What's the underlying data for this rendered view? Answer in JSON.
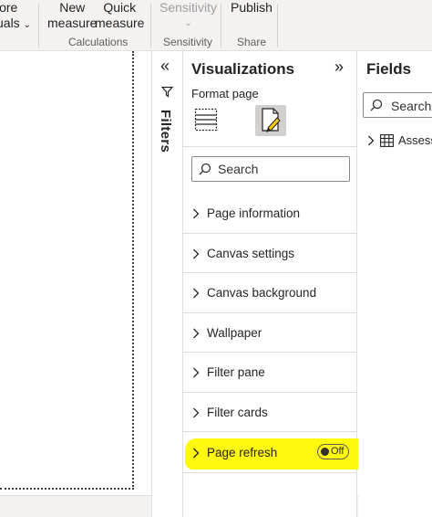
{
  "ribbon": {
    "more_visuals": {
      "line1": "lore",
      "line2": "uals"
    },
    "new_measure": {
      "line1": "New",
      "line2": "measure"
    },
    "quick_measure": {
      "line1": "Quick",
      "line2": "measure"
    },
    "sensitivity": {
      "line1": "Sensitivity"
    },
    "publish": {
      "line1": "Publish"
    },
    "groups": {
      "calculations": "Calculations",
      "sensitivity": "Sensitivity",
      "share": "Share"
    }
  },
  "filters": {
    "label": "Filters"
  },
  "visualizations": {
    "title": "Visualizations",
    "subtitle": "Format page",
    "search_placeholder": "Search",
    "sections": [
      {
        "label": "Page information"
      },
      {
        "label": "Canvas settings"
      },
      {
        "label": "Canvas background"
      },
      {
        "label": "Wallpaper"
      },
      {
        "label": "Filter pane"
      },
      {
        "label": "Filter cards"
      },
      {
        "label": "Page refresh",
        "toggle": "Off"
      }
    ]
  },
  "fields": {
    "title": "Fields",
    "search_placeholder": "Search",
    "items": [
      {
        "label": "Assess"
      }
    ]
  },
  "colors": {
    "highlight": "#fffa00",
    "pane_bg": "#ffffff",
    "ribbon_bg": "#f3f2f1"
  }
}
